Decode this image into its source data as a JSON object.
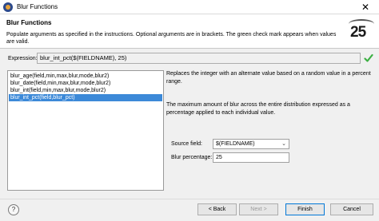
{
  "window": {
    "title": "Blur Functions",
    "close_glyph": "✕"
  },
  "header": {
    "title": "Blur Functions",
    "description": "Populate arguments as specified in the instructions. Optional arguments are in brackets. The green check mark appears when values are valid.",
    "logo_text": "25"
  },
  "expression": {
    "label": "Expression:",
    "value": "blur_int_pct($(FIELDNAME), 25)",
    "valid_icon": "check-icon",
    "valid_color": "#3cb043"
  },
  "functions": {
    "items": [
      {
        "label": "blur_age(field,min,max,blur,mode,blur2)",
        "selected": false
      },
      {
        "label": "blur_date(field,min,max,blur,mode,blur2)",
        "selected": false
      },
      {
        "label": "blur_int(field,min,max,blur,mode,blur2)",
        "selected": false
      },
      {
        "label": "blur_int_pct(field,blur_pct)",
        "selected": true
      }
    ],
    "selection_color": "#3c89d8"
  },
  "details": {
    "description": "Replaces the integer with an alternate value based on a random value in a percent range.",
    "blur_help": "The maximum amount of blur across the entire distribution expressed as a percentage applied to each individual value."
  },
  "form": {
    "source_field_label": "Source field:",
    "source_field_value": "$(FIELDNAME)",
    "blur_percentage_label": "Blur percentage:",
    "blur_percentage_value": "25"
  },
  "footer": {
    "help_glyph": "?",
    "back_label": "< Back",
    "next_label": "Next >",
    "finish_label": "Finish",
    "cancel_label": "Cancel"
  }
}
